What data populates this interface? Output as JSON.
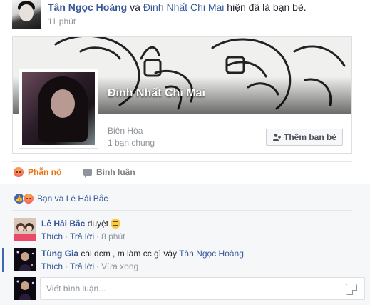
{
  "post": {
    "actor_name": "Tân Ngọc Hoàng",
    "connector": " và ",
    "friend_name": "Đinh Nhất Chi Mai",
    "action_text": " hiện đã là bạn bè.",
    "time": "11 phút"
  },
  "card": {
    "name": "Đinh Nhất Chi Mai",
    "location": "Biên Hòa",
    "mutual": "1 bạn chung",
    "add_friend_label": "Thêm bạn bè"
  },
  "actions": {
    "react_label": "Phẫn nộ",
    "comment_label": "Bình luận"
  },
  "reactions": {
    "summary": "Bạn và Lê Hải Bắc"
  },
  "comments": [
    {
      "author": "Lê Hải Bắc",
      "text": "duyệt",
      "like_label": "Thích",
      "reply_label": "Trả lời",
      "time": "8 phút"
    },
    {
      "author": "Tùng Gia",
      "text": "cái đcm , m làm cc gì vậy",
      "mention": "Tân Ngọc Hoàng",
      "like_label": "Thích",
      "reply_label": "Trả lời",
      "time": "Vừa xong"
    }
  ],
  "composer": {
    "placeholder": "Viết bình luận..."
  },
  "colors": {
    "link": "#365899",
    "angry": "#e9710f",
    "like": "#4267b2"
  }
}
